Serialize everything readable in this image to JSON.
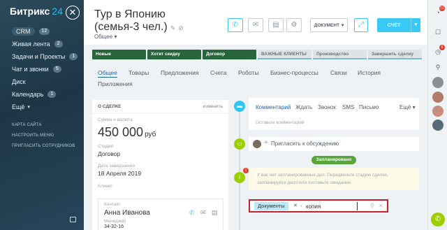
{
  "sidebar": {
    "logo_text": "Битрикс",
    "logo_num": "24",
    "items": [
      {
        "label": "CRM",
        "count": "12"
      },
      {
        "label": "Живая лента",
        "count": "2"
      },
      {
        "label": "Задачи и Проекты",
        "count": "1"
      },
      {
        "label": "Чат и звонки",
        "count": "5"
      },
      {
        "label": "Диск",
        "count": ""
      },
      {
        "label": "Календарь",
        "count": "1"
      },
      {
        "label": "Ещё",
        "count": ""
      }
    ],
    "small_links": [
      "КАРТА САЙТА",
      "НАСТРОИТЬ МЕНЮ",
      "ПРИГЛАСИТЬ СОТРУДНИКОВ"
    ]
  },
  "header": {
    "title": "Тур в Японию (семья-3 чел.)",
    "category": "Общее",
    "category_arrow": "▾",
    "document_label": "ДОКУМЕНТ",
    "invoice_label": "СЧЁТ"
  },
  "stages": [
    {
      "label": "Новые",
      "done": true
    },
    {
      "label": "Хотят скидку",
      "done": true
    },
    {
      "label": "Договор",
      "done": true
    },
    {
      "label": "ВАЖНЫЕ КЛИЕНТЫ",
      "done": false
    },
    {
      "label": "Производство",
      "done": false
    },
    {
      "label": "Завершить сделку",
      "done": false
    }
  ],
  "tabs": [
    "Общее",
    "Товары",
    "Предложения",
    "Счета",
    "Роботы",
    "Бизнес-процессы",
    "Связи",
    "История",
    "Приложения"
  ],
  "card": {
    "title": "О СДЕЛКЕ",
    "edit_label": "изменить",
    "amount_label": "Сумма и валюта",
    "amount": "450 000",
    "currency": "руб",
    "stage_label": "Стадия",
    "stage_value": "Договор",
    "close_date_label": "Дата завершения",
    "close_date_value": "18 Апреля 2019",
    "client_label": "Клиент",
    "contact_label": "Контакт",
    "contact_name": "Анна Иванова",
    "contact_role": "Менеджер",
    "contact_phone": "34-32-16"
  },
  "timeline": {
    "comment_tabs": [
      "Комментарий",
      "Ждать",
      "Звонок",
      "SMS",
      "Письмо",
      "Ещё ▾"
    ],
    "comment_placeholder": "Оставьте комментарий",
    "invite_text": "Пригласить к обсуждению",
    "planned_badge": "Запланировано",
    "notice_count": "1",
    "notice_text": "У вас нет запланированных дел. Передвиньте стадию сделки, запланируйте дело или поставьте ожидание."
  },
  "search": {
    "tag": "Документы",
    "separator": "-",
    "value": "копия"
  },
  "rightbar": {
    "badge_top": "10",
    "badge_mid": "5"
  },
  "colors": {
    "accent": "#3bc8f5",
    "stage_done": "#27663a",
    "planned": "#58a53d",
    "highlight": "#c6202a"
  }
}
